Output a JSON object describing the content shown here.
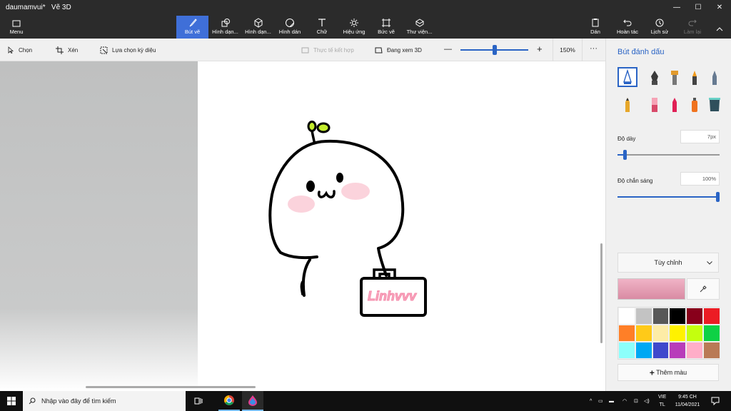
{
  "window": {
    "title": "daumamvui*   Vẽ 3D",
    "buttons": {
      "minimize": "—",
      "maximize": "☐",
      "close": "✕"
    }
  },
  "ribbon": {
    "menu": "Menu",
    "tools": [
      {
        "label": "Bút vẽ",
        "icon": "brush-icon"
      },
      {
        "label": "Hình dạn...",
        "icon": "2d-shapes-icon"
      },
      {
        "label": "Hình dạn...",
        "icon": "3d-shapes-icon"
      },
      {
        "label": "Hình dán",
        "icon": "stickers-icon"
      },
      {
        "label": "Chữ",
        "icon": "text-icon"
      },
      {
        "label": "Hiệu ứng",
        "icon": "effects-icon"
      },
      {
        "label": "Bức vẽ",
        "icon": "canvas-icon"
      },
      {
        "label": "Thư viện...",
        "icon": "library-icon"
      }
    ],
    "right": [
      {
        "label": "Dán",
        "icon": "paste-icon"
      },
      {
        "label": "Hoàn tác",
        "icon": "undo-icon"
      },
      {
        "label": "Lịch sử",
        "icon": "history-icon"
      },
      {
        "label": "Làm lại",
        "icon": "redo-icon"
      }
    ]
  },
  "toolbar": {
    "select": "Chọn",
    "crop": "Xén",
    "magic_select": "Lựa chọn kỳ diệu",
    "mixed_reality": "Thực tế kết hợp",
    "view_3d": "Đang xem 3D",
    "zoom": "150%",
    "zoom_level": 0.47,
    "more": "···"
  },
  "panel": {
    "title": "Bút đánh dấu",
    "thickness_label": "Độ dày",
    "thickness_value": "7px",
    "thickness_level": 0.07,
    "opacity_label": "Độ chắn sáng",
    "opacity_value": "100%",
    "opacity_level": 1.0,
    "texture": "Tùy chỉnh",
    "current_color": "#f0b3c6",
    "add_color": "Thêm màu",
    "palette": [
      "#ffffff",
      "#c3c3c3",
      "#585858",
      "#000000",
      "#88001b",
      "#ec1c24",
      "#ff7f27",
      "#ffca18",
      "#fdeca6",
      "#fff200",
      "#c4ff0e",
      "#0ed145",
      "#8cfffb",
      "#00a8f3",
      "#3f48cc",
      "#b83dba",
      "#ffaec8",
      "#b97a56"
    ]
  },
  "canvas": {
    "bag_text": "Linhvvv"
  },
  "taskbar": {
    "search_placeholder": "Nhập vào đây để tìm kiếm",
    "lang_top": "VIE",
    "lang_bottom": "TL",
    "time": "9:45 CH",
    "date": "11/04/2021"
  }
}
